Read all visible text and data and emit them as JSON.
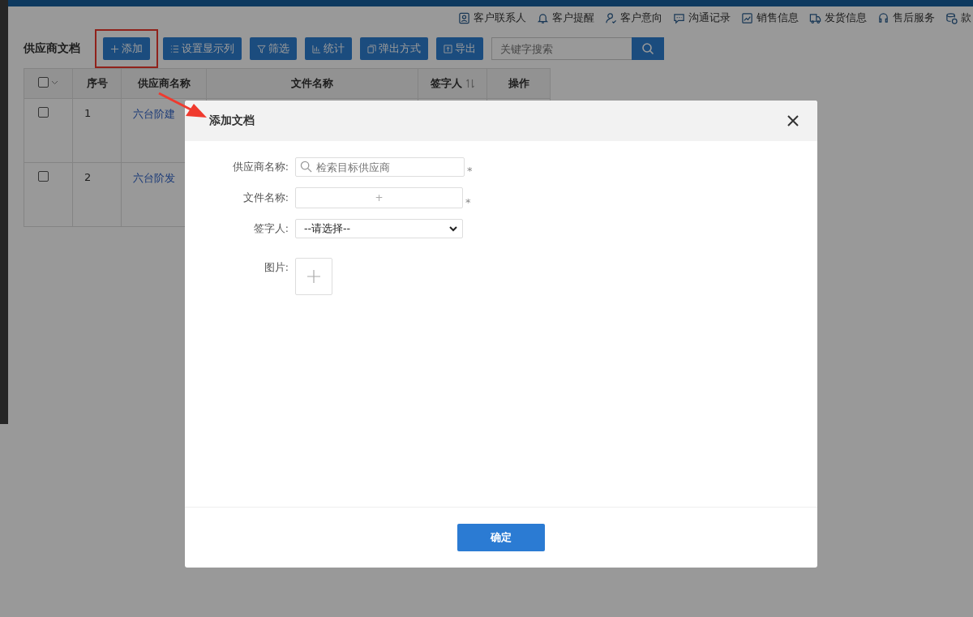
{
  "top_nav": [
    {
      "label": "客户联系人"
    },
    {
      "label": "客户提醒"
    },
    {
      "label": "客户意向"
    },
    {
      "label": "沟通记录"
    },
    {
      "label": "销售信息"
    },
    {
      "label": "发货信息"
    },
    {
      "label": "售后服务"
    },
    {
      "label": "款"
    }
  ],
  "page_title": "供应商文档",
  "toolbar": [
    {
      "label": "添加",
      "highlighted": true
    },
    {
      "label": "设置显示列",
      "highlighted": false
    },
    {
      "label": "筛选",
      "highlighted": false
    },
    {
      "label": "统计",
      "highlighted": false
    },
    {
      "label": "弹出方式",
      "highlighted": false
    },
    {
      "label": "导出",
      "highlighted": false
    }
  ],
  "search": {
    "placeholder": "关键字搜索"
  },
  "table": {
    "header_checkbox": {
      "checked": false
    },
    "columns": [
      {
        "label": "序号",
        "sortable": false
      },
      {
        "label": "供应商名称",
        "sortable": false
      },
      {
        "label": "文件名称",
        "sortable": false
      },
      {
        "label": "签字人",
        "sortable": true
      },
      {
        "label": "操作",
        "sortable": false
      }
    ],
    "rows": [
      {
        "checked": false,
        "index": "1",
        "supplier": "六台阶建"
      },
      {
        "checked": false,
        "index": "2",
        "supplier": "六台阶发"
      }
    ]
  },
  "modal": {
    "title": "添加文档",
    "fields": [
      {
        "kind": "search",
        "label": "供应商名称:",
        "placeholder": "检索目标供应商",
        "required_mark": "*"
      },
      {
        "kind": "file",
        "label": "文件名称:",
        "button": "+",
        "required_mark": "*"
      },
      {
        "kind": "select",
        "label": "签字人:",
        "value": "--请选择--"
      },
      {
        "kind": "image",
        "label": "图片:"
      }
    ],
    "confirm_button": "确定"
  }
}
